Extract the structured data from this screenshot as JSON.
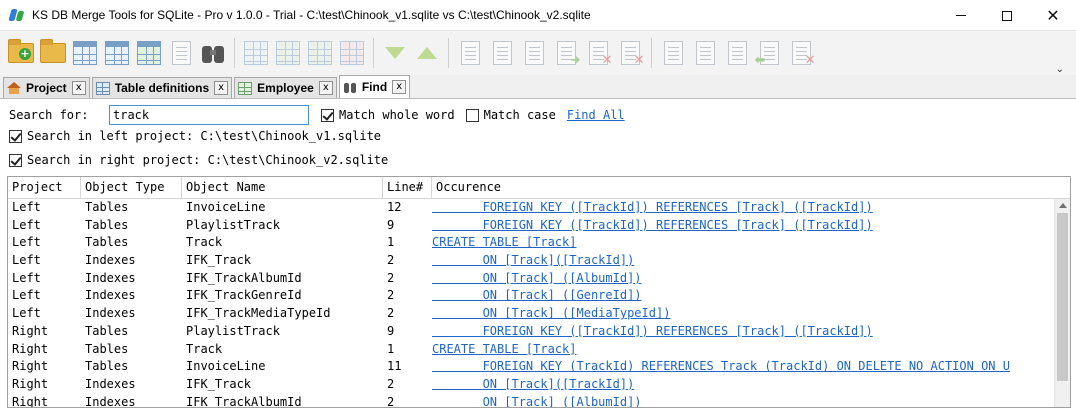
{
  "window": {
    "title": "KS DB Merge Tools for SQLite - Pro v 1.0.0 - Trial - C:\\test\\Chinook_v1.sqlite vs C:\\test\\Chinook_v2.sqlite",
    "minimize_icon": "minimize-icon",
    "maximize_icon": "maximize-icon",
    "close_glyph": "✕"
  },
  "toolbar": {
    "icons": [
      "new-project-icon",
      "open-project-icon",
      "compare-tables-icon",
      "select-query-icon",
      "schema-report-icon",
      "export-icon",
      "find-binoculars-icon",
      "table-grid-icon",
      "table-grid-left-icon",
      "table-grid-right-icon",
      "table-grid-diff-icon",
      "next-diff-icon",
      "prev-diff-icon",
      "copy-doc-icon",
      "merge-doc-icon",
      "script-doc-icon",
      "apply-right-icon",
      "delete-right-icon",
      "delete-doc-icon",
      "left-doc-icon",
      "left-doc-2-icon",
      "sync-doc-icon",
      "apply-left-icon",
      "delete-left-icon"
    ],
    "overflow_glyph": "⌄"
  },
  "tabs": [
    {
      "label": "Project",
      "icon": "home-icon",
      "close": "x"
    },
    {
      "label": "Table definitions",
      "icon": "table-icon",
      "close": "x"
    },
    {
      "label": "Employee",
      "icon": "table-icon",
      "close": "x"
    },
    {
      "label": "Find",
      "icon": "binoculars-icon",
      "close": "x"
    }
  ],
  "search": {
    "label": "Search for:",
    "value": "track",
    "match_whole_word": {
      "label": "Match whole word",
      "checked": true
    },
    "match_case": {
      "label": "Match case",
      "checked": false
    },
    "find_all": "Find All",
    "left_project": {
      "label": "Search in left project:",
      "path": "C:\\test\\Chinook_v1.sqlite",
      "checked": true
    },
    "right_project": {
      "label": "Search in right project:",
      "path": "C:\\test\\Chinook_v2.sqlite",
      "checked": true
    }
  },
  "results": {
    "columns": [
      "Project",
      "Object Type",
      "Object Name",
      "Line#",
      "Occurence"
    ],
    "rows": [
      [
        "Left",
        "Tables",
        "InvoiceLine",
        "12",
        "       FOREIGN KEY ([TrackId]) REFERENCES [Track] ([TrackId])"
      ],
      [
        "Left",
        "Tables",
        "PlaylistTrack",
        "9",
        "       FOREIGN KEY ([TrackId]) REFERENCES [Track] ([TrackId])"
      ],
      [
        "Left",
        "Tables",
        "Track",
        "1",
        "CREATE TABLE [Track]"
      ],
      [
        "Left",
        "Indexes",
        "IFK_Track",
        "2",
        "       ON [Track]([TrackId])"
      ],
      [
        "Left",
        "Indexes",
        "IFK_TrackAlbumId",
        "2",
        "       ON [Track] ([AlbumId])"
      ],
      [
        "Left",
        "Indexes",
        "IFK_TrackGenreId",
        "2",
        "       ON [Track] ([GenreId])"
      ],
      [
        "Left",
        "Indexes",
        "IFK_TrackMediaTypeId",
        "2",
        "       ON [Track] ([MediaTypeId])"
      ],
      [
        "Right",
        "Tables",
        "PlaylistTrack",
        "9",
        "       FOREIGN KEY ([TrackId]) REFERENCES [Track] ([TrackId])"
      ],
      [
        "Right",
        "Tables",
        "Track",
        "1",
        "CREATE TABLE [Track]"
      ],
      [
        "Right",
        "Tables",
        "InvoiceLine",
        "11",
        "       FOREIGN KEY (TrackId) REFERENCES Track (TrackId) ON DELETE NO ACTION ON U"
      ],
      [
        "Right",
        "Indexes",
        "IFK_Track",
        "2",
        "       ON [Track]([TrackId])"
      ],
      [
        "Right",
        "Indexes",
        "IFK_TrackAlbumId",
        "2",
        "       ON [Track] ([AlbumId])"
      ]
    ]
  }
}
